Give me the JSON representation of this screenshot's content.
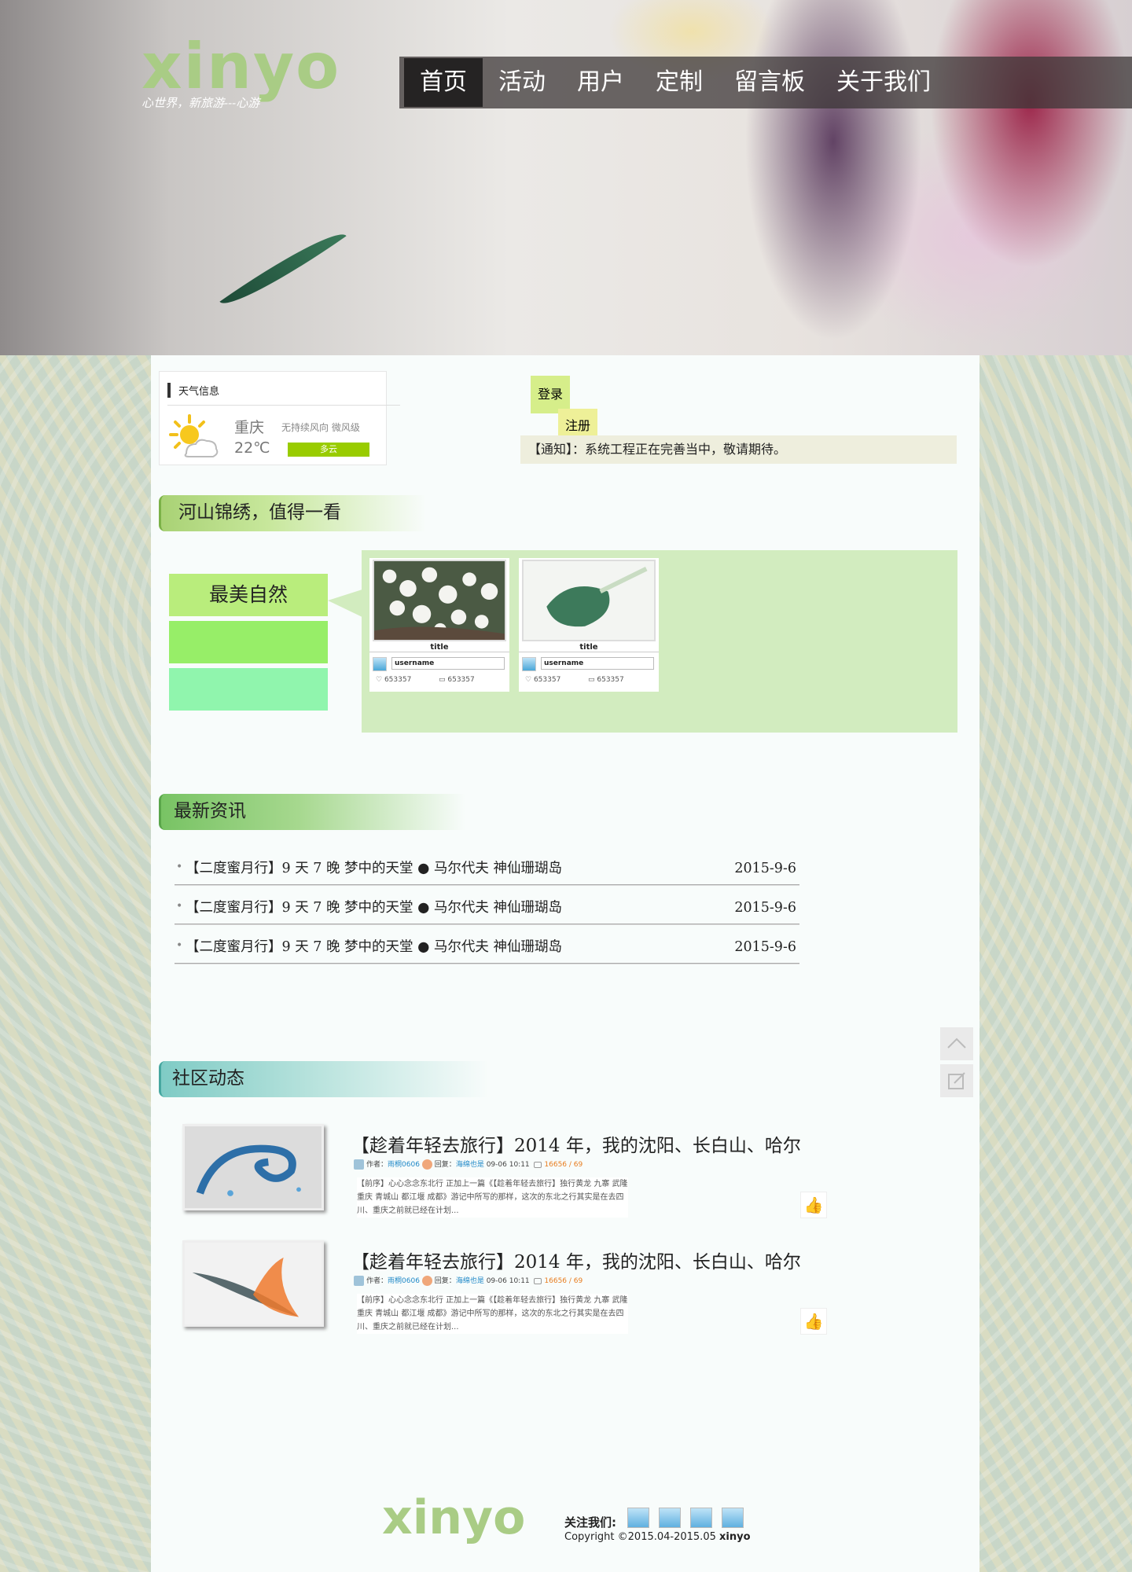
{
  "header": {
    "logo": "xinyo",
    "slogan": "心世界，新旅游---心游",
    "nav": [
      {
        "label": "首页",
        "active": true
      },
      {
        "label": "活动",
        "active": false
      },
      {
        "label": "用户",
        "active": false
      },
      {
        "label": "定制",
        "active": false
      },
      {
        "label": "留言板",
        "active": false
      },
      {
        "label": "关于我们",
        "active": false
      }
    ]
  },
  "weather": {
    "title": "天气信息",
    "city": "重庆",
    "wind": "无持续风向  微风级",
    "temp": "22℃",
    "condition": "多云",
    "icon": "sun-cloud-icon"
  },
  "auth": {
    "login": "登录",
    "register": "注册"
  },
  "notice": "【通知】：系统工程正在完善当中，敬请期待。",
  "scenery": {
    "header": "河山锦绣，值得一看",
    "categories": [
      {
        "label": "最美自然",
        "color": "#b9ed7c"
      },
      {
        "label": "",
        "color": "#97ee68"
      },
      {
        "label": "",
        "color": "#90f5ad"
      }
    ],
    "cards": [
      {
        "title": "title",
        "username": "username",
        "likes": "653357",
        "comments": "653357"
      },
      {
        "title": "title",
        "username": "username",
        "likes": "653357",
        "comments": "653357"
      }
    ]
  },
  "news": {
    "header": "最新资讯",
    "items": [
      {
        "text": "【二度蜜月行】9 天 7 晚  梦中的天堂  ●  马尔代夫  神仙珊瑚岛",
        "date": "2015-9-6"
      },
      {
        "text": "【二度蜜月行】9 天 7 晚  梦中的天堂  ●  马尔代夫  神仙珊瑚岛",
        "date": "2015-9-6"
      },
      {
        "text": "【二度蜜月行】9 天 7 晚  梦中的天堂  ●  马尔代夫  神仙珊瑚岛",
        "date": "2015-9-6"
      }
    ]
  },
  "community": {
    "header": "社区动态",
    "posts": [
      {
        "title": "【趁着年轻去旅行】2014 年，我的沈阳、长白山、哈尔",
        "author_label": "作者：",
        "author": "雨桐0606",
        "reply_label": "回复：",
        "replier": "海绵也是",
        "time": "09-06 10:11",
        "stats": "16656 / 69",
        "excerpt": "【前序】心心念念东北行 正加上一篇《【趁着年轻去旅行】独行黄龙 九寨 武隆 重庆 青城山 都江堰 成都》游记中所写的那样，这次的东北之行其实是在去四川、重庆之前就已经在计划..."
      },
      {
        "title": "【趁着年轻去旅行】2014 年，我的沈阳、长白山、哈尔",
        "author_label": "作者：",
        "author": "雨桐0606",
        "reply_label": "回复：",
        "replier": "海绵也是",
        "time": "09-06 10:11",
        "stats": "16656 / 69",
        "excerpt": "【前序】心心念念东北行 正加上一篇《【趁着年轻去旅行】独行黄龙 九寨 武隆 重庆 青城山 都江堰 成都》游记中所写的那样，这次的东北之行其实是在去四川、重庆之前就已经在计划..."
      }
    ]
  },
  "sidebar_tools": [
    {
      "icon": "scroll-top-icon"
    },
    {
      "icon": "edit-icon"
    }
  ],
  "footer": {
    "logo": "xinyo",
    "follow_label": "关注我们:",
    "copyright": "Copyright  ©2015.04-2015.05",
    "brand": "xinyo",
    "social_icons": [
      "social-icon-1",
      "social-icon-2",
      "social-icon-3",
      "social-icon-4"
    ]
  }
}
